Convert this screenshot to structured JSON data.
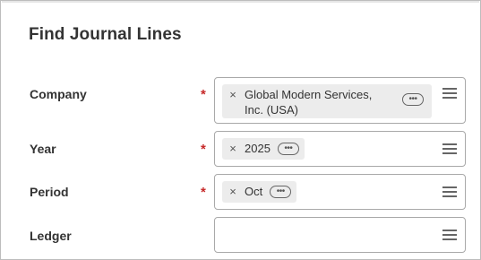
{
  "title": "Find Journal Lines",
  "fields": [
    {
      "label": "Company",
      "required": true,
      "value": "Global Modern Services, Inc. (USA)",
      "value_line1": "Global Modern Services,",
      "value_line2": "Inc. (USA)",
      "remove_glyph": "×",
      "more_glyph": "•••",
      "list_icon": "list-icon"
    },
    {
      "label": "Year",
      "required": true,
      "value": "2025",
      "remove_glyph": "×",
      "more_glyph": "•••",
      "list_icon": "list-icon"
    },
    {
      "label": "Period",
      "required": true,
      "value": "Oct",
      "remove_glyph": "×",
      "more_glyph": "•••",
      "list_icon": "list-icon"
    },
    {
      "label": "Ledger",
      "required": false,
      "value": "",
      "list_icon": "list-icon"
    }
  ],
  "required_marker": "*",
  "colors": {
    "required": "#c62828",
    "pill": "#ececec",
    "border": "#a9a9a9",
    "text": "#333333"
  }
}
